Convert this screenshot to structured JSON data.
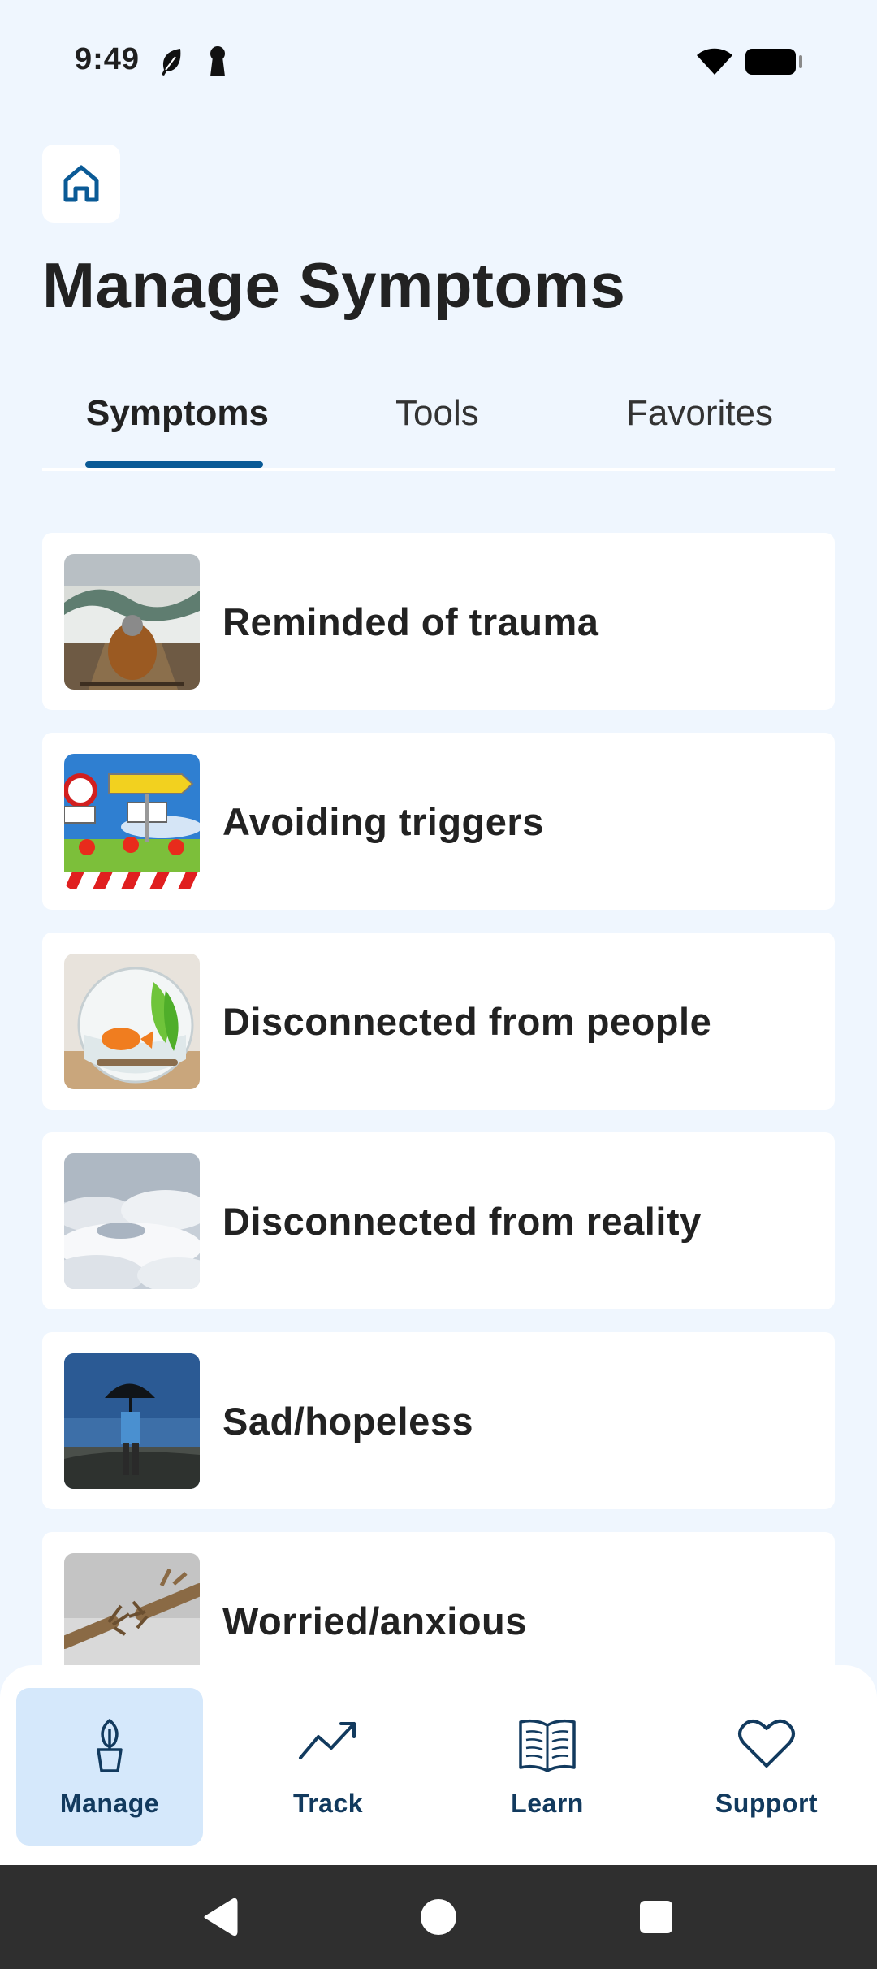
{
  "status_bar": {
    "time": "9:49",
    "icons": [
      "leaf-icon",
      "keyhole-icon",
      "wifi-icon",
      "battery-icon"
    ]
  },
  "header": {
    "home_icon": "home-icon",
    "title": "Manage Symptoms"
  },
  "tabs": [
    {
      "label": "Symptoms",
      "active": true
    },
    {
      "label": "Tools",
      "active": false
    },
    {
      "label": "Favorites",
      "active": false
    }
  ],
  "symptoms": [
    {
      "label": "Reminded of trauma",
      "image": "person-in-boat-stormy-sea"
    },
    {
      "label": "Avoiding triggers",
      "image": "road-signs-and-barrier"
    },
    {
      "label": "Disconnected from people",
      "image": "goldfish-in-bowl"
    },
    {
      "label": "Disconnected from reality",
      "image": "above-the-clouds"
    },
    {
      "label": "Sad/hopeless",
      "image": "person-with-umbrella-in-rain"
    },
    {
      "label": "Worried/anxious",
      "image": "fraying-rope"
    }
  ],
  "bottom_nav": [
    {
      "label": "Manage",
      "icon": "plant-pot-icon",
      "active": true
    },
    {
      "label": "Track",
      "icon": "trend-line-icon",
      "active": false
    },
    {
      "label": "Learn",
      "icon": "open-book-icon",
      "active": false
    },
    {
      "label": "Support",
      "icon": "heart-icon",
      "active": false
    }
  ],
  "colors": {
    "background": "#eff6fe",
    "accent": "#0a5a96",
    "active_nav_bg": "#d5e8fb",
    "nav_text": "#123a5e"
  }
}
